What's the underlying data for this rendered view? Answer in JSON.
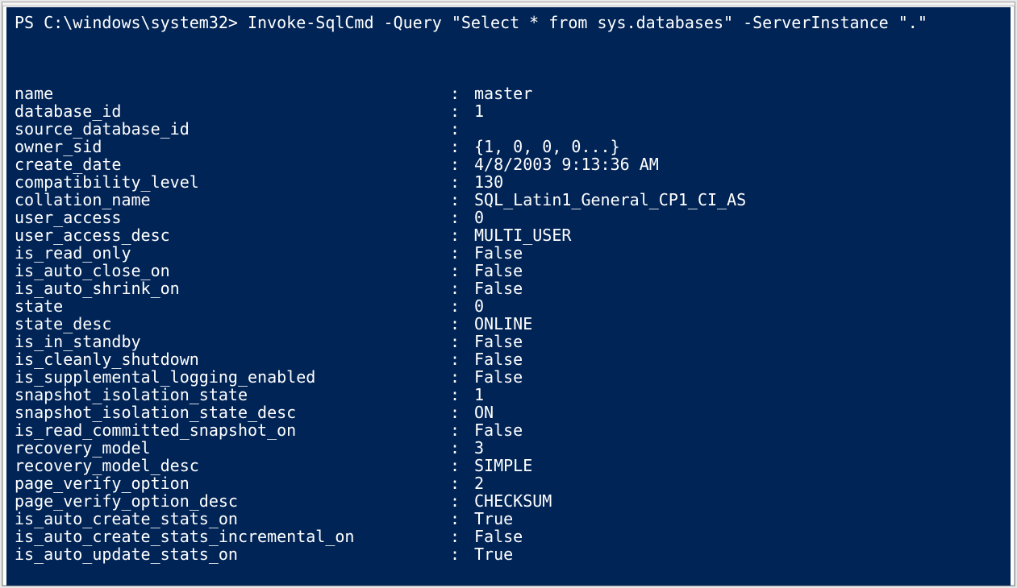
{
  "prompt": "PS C:\\windows\\system32> ",
  "command": "Invoke-SqlCmd -Query \"Select * from sys.databases\" -ServerInstance \".\"",
  "separator": ":",
  "rows": [
    {
      "key": "name",
      "value": "master"
    },
    {
      "key": "database_id",
      "value": "1"
    },
    {
      "key": "source_database_id",
      "value": ""
    },
    {
      "key": "owner_sid",
      "value": "{1, 0, 0, 0...}"
    },
    {
      "key": "create_date",
      "value": "4/8/2003 9:13:36 AM"
    },
    {
      "key": "compatibility_level",
      "value": "130"
    },
    {
      "key": "collation_name",
      "value": "SQL_Latin1_General_CP1_CI_AS"
    },
    {
      "key": "user_access",
      "value": "0"
    },
    {
      "key": "user_access_desc",
      "value": "MULTI_USER"
    },
    {
      "key": "is_read_only",
      "value": "False"
    },
    {
      "key": "is_auto_close_on",
      "value": "False"
    },
    {
      "key": "is_auto_shrink_on",
      "value": "False"
    },
    {
      "key": "state",
      "value": "0"
    },
    {
      "key": "state_desc",
      "value": "ONLINE"
    },
    {
      "key": "is_in_standby",
      "value": "False"
    },
    {
      "key": "is_cleanly_shutdown",
      "value": "False"
    },
    {
      "key": "is_supplemental_logging_enabled",
      "value": "False"
    },
    {
      "key": "snapshot_isolation_state",
      "value": "1"
    },
    {
      "key": "snapshot_isolation_state_desc",
      "value": "ON"
    },
    {
      "key": "is_read_committed_snapshot_on",
      "value": "False"
    },
    {
      "key": "recovery_model",
      "value": "3"
    },
    {
      "key": "recovery_model_desc",
      "value": "SIMPLE"
    },
    {
      "key": "page_verify_option",
      "value": "2"
    },
    {
      "key": "page_verify_option_desc",
      "value": "CHECKSUM"
    },
    {
      "key": "is_auto_create_stats_on",
      "value": "True"
    },
    {
      "key": "is_auto_create_stats_incremental_on",
      "value": "False"
    },
    {
      "key": "is_auto_update_stats_on",
      "value": "True"
    }
  ]
}
